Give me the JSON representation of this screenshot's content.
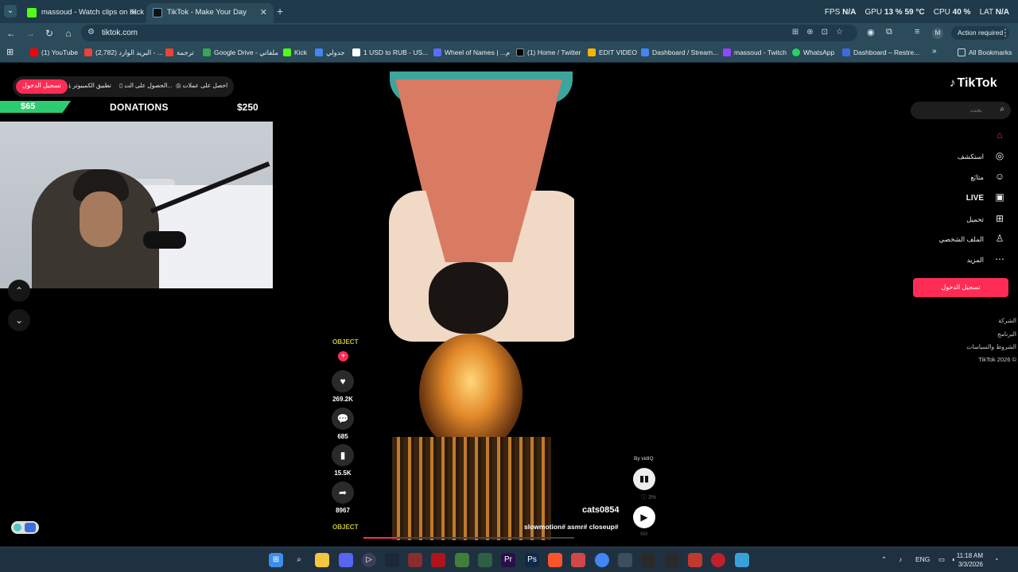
{
  "browser": {
    "tabs": [
      {
        "label": "massoud - Watch clips on Kick",
        "active": false,
        "favicon_color": "#53fc18"
      },
      {
        "label": "TikTok - Make Your Day",
        "active": true,
        "favicon_color": "#000000"
      }
    ],
    "url": "tiktok.com",
    "action_required": "Action required",
    "profile_initial": "M",
    "new_tab": "+"
  },
  "overlay_stats": {
    "fps_label": "FPS",
    "fps_value": "N/A",
    "gpu_label": "GPU",
    "gpu_value": "13 %",
    "gpu_temp": "59 °C",
    "cpu_label": "CPU",
    "cpu_value": "40 %",
    "lat_label": "LAT",
    "lat_value": "N/A"
  },
  "bookmarks": [
    {
      "label": "(1) YouTube",
      "color": "#ff0000"
    },
    {
      "label": "(2,782) البريد الوارد - ...",
      "color": "#ea4335"
    },
    {
      "label": "ترجمة",
      "color": "#ea4335"
    },
    {
      "label": "Google Drive - ملفاتي",
      "color": "#34a853"
    },
    {
      "label": "Kick",
      "color": "#53fc18"
    },
    {
      "label": "جدولي",
      "color": "#4285f4"
    },
    {
      "label": "1 USD to RUB - US...",
      "color": "#ffffff"
    },
    {
      "label": "Wheel of Names | ...م",
      "color": "#5b6cff"
    },
    {
      "label": "(1) Home / Twitter",
      "color": "#000000"
    },
    {
      "label": "EDIT VIDEO",
      "color": "#f4b400"
    },
    {
      "label": "Dashboard / Stream...",
      "color": "#4285f4"
    },
    {
      "label": "massoud - Twitch",
      "color": "#9146ff"
    },
    {
      "label": "WhatsApp",
      "color": "#25d366"
    },
    {
      "label": "Dashboard – Restre...",
      "color": "#3d6ae0"
    }
  ],
  "bookmarks_more": "»",
  "all_bookmarks": "All Bookmarks",
  "top_chips": {
    "login": "تسجيل الدخول",
    "computer_app": "تطبيق الكمبيوتر",
    "get_app": "الحصول على الت...",
    "get_coins": "احصل على عملات"
  },
  "donations": {
    "current": "$65",
    "title": "DONATIONS",
    "goal": "$250",
    "progress": 0.26
  },
  "video": {
    "username": "cats0854",
    "hashtags": "slowmotion# asmr# closeup#",
    "progress": 0.16,
    "rail_logo": "OBJECT",
    "bottom_logo": "OBJECT",
    "likes": "269.2K",
    "comments": "685",
    "saves": "15.5K",
    "shares": "8967"
  },
  "vidiq": {
    "label": "By vidIQ",
    "info": "3%",
    "play_sub": "9M"
  },
  "sidebar": {
    "logo": "TikTok",
    "search_placeholder": "بحث",
    "items": [
      {
        "label": "",
        "icon": "home-icon"
      },
      {
        "label": "استكشف",
        "icon": "compass-icon"
      },
      {
        "label": "متابَع",
        "icon": "following-icon"
      },
      {
        "label": "LIVE",
        "icon": "live-icon"
      },
      {
        "label": "تحميل",
        "icon": "upload-icon"
      },
      {
        "label": "الملف الشخصي",
        "icon": "profile-icon"
      },
      {
        "label": "المزيد",
        "icon": "more-icon"
      }
    ],
    "login_button": "تسجيل الدخول",
    "footer": [
      "الشركة",
      "البرنامج",
      "الشروط والسياسات",
      "TikTok 2026 ©"
    ]
  },
  "taskbar": {
    "language": "ENG",
    "time": "11:18 AM",
    "date": "3/3/2026"
  }
}
